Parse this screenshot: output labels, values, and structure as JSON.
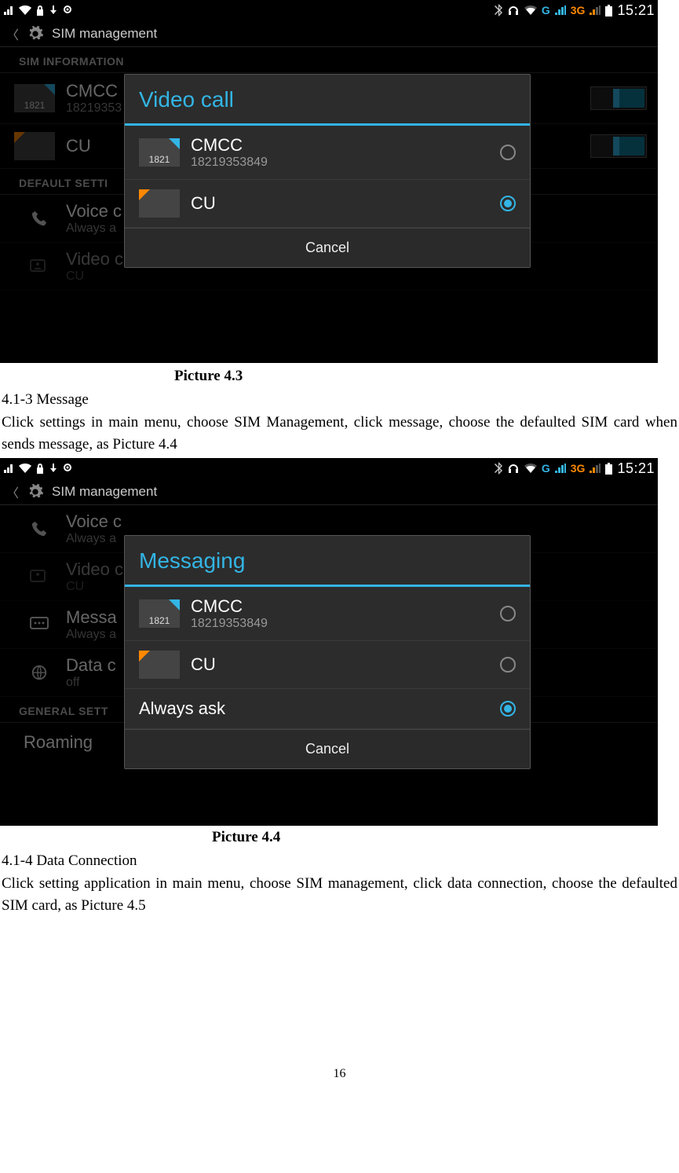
{
  "status": {
    "clock": "15:21",
    "g_label": "G",
    "threeg_label": "3G"
  },
  "settings_title": "SIM management",
  "sections": {
    "sim_info": "SIM INFORMATION",
    "default": "DEFAULT SETTINGS",
    "default_cut": "DEFAULT SETTI",
    "general": "GENERAL SETT"
  },
  "sims": {
    "cmcc": {
      "name": "CMCC",
      "number": "18219353849",
      "number_cut": "18219353",
      "chip": "1821"
    },
    "cu": {
      "name": "CU"
    }
  },
  "rows": {
    "voice": {
      "title": "Voice call",
      "title_cut": "Voice c",
      "sub": "Always ask",
      "sub_cut": "Always a"
    },
    "video": {
      "title": "Video call",
      "title_cut": "Video c",
      "sub": "CU"
    },
    "message": {
      "title_cut": "Messa",
      "sub_cut": "Always a"
    },
    "data": {
      "title_cut": "Data c",
      "sub": "off"
    },
    "roaming": "Roaming"
  },
  "modals": {
    "video": {
      "title": "Video call",
      "cancel": "Cancel"
    },
    "messaging": {
      "title": "Messaging",
      "always": "Always ask",
      "cancel": "Cancel"
    }
  },
  "doc": {
    "cap43": "Picture 4.3",
    "h413": "4.1-3 Message",
    "p413": "Click settings in main menu, choose SIM Management, click message, choose the defaulted SIM card when sends message, as Picture 4.4",
    "cap44": "Picture 4.4",
    "h414": "4.1-4 Data Connection",
    "p414": "Click setting application in main menu, choose SIM management, click data connection, choose the defaulted SIM card, as Picture 4.5",
    "pagenum": "16"
  }
}
